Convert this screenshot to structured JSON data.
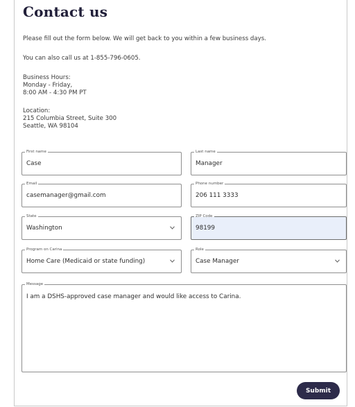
{
  "page": {
    "title": "Contact us",
    "intro": "Please fill out the form below. We will get back to you within a few business days.",
    "call_text": "You can also call us at 1-855-796-0605.",
    "hours_heading": "Business Hours:",
    "hours_days": "Monday - Friday,",
    "hours_time": "8:00 AM - 4:30 PM PT",
    "location_heading": "Location:",
    "location_street": "215 Columbia Street, Suite 300",
    "location_city": "Seattle, WA 98104"
  },
  "form": {
    "first_name": {
      "label": "First name",
      "value": "Case"
    },
    "last_name": {
      "label": "Last name",
      "value": "Manager"
    },
    "email": {
      "label": "Email",
      "value": "casemanager@gmail.com"
    },
    "phone": {
      "label": "Phone number",
      "value": "206 111 3333"
    },
    "state": {
      "label": "State",
      "value": "Washington"
    },
    "zip": {
      "label": "ZIP Code",
      "value": "98199"
    },
    "program": {
      "label": "Program on Carina",
      "value": "Home Care (Medicaid or state funding)"
    },
    "role": {
      "label": "Role",
      "value": "Case Manager"
    },
    "message": {
      "label": "Message",
      "value": "I am a DSHS-approved case manager and would like access to Carina."
    },
    "submit_label": "Submit"
  },
  "icons": {
    "dropdown": "chevron-down-icon"
  },
  "colors": {
    "button_bg": "#2d2b4a",
    "focused_field_bg": "#e9effa",
    "title": "#22203a"
  }
}
